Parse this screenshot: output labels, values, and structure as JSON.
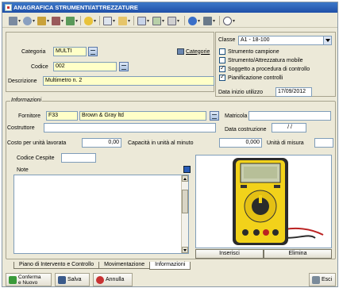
{
  "window": {
    "title": "ANAGRAFICA STRUMENTI/ATTREZZATURE"
  },
  "header_form": {
    "categoria_label": "Categoria",
    "categoria_value": "MULTI",
    "codice_label": "Codice",
    "codice_value": "002",
    "descrizione_label": "Descrizione",
    "descrizione_value": "Multimetro n. 2",
    "categorie_link": "Categorie"
  },
  "right_panel": {
    "classe_label": "Classe",
    "classe_value": "A1 - 18-100",
    "checkboxes": [
      {
        "label": "Strumento campione",
        "checked": false
      },
      {
        "label": "Strumento/Attrezzatura mobile",
        "checked": false
      },
      {
        "label": "Soggetto a procedura di controllo",
        "checked": true
      },
      {
        "label": "Pianificazione controlli",
        "checked": true
      }
    ],
    "data_inizio_label": "Data inizio utilizzo",
    "data_inizio_value": "17/09/2012"
  },
  "informazioni": {
    "legend": "Informazioni",
    "fornitore_label": "Fornitore",
    "fornitore_code": "F33",
    "fornitore_name": "Brown & Gray ltd",
    "matricola_label": "Matricola",
    "matricola_value": "",
    "costruttore_label": "Costruttore",
    "costruttore_value": "",
    "data_costruzione_label": "Data costruzione",
    "data_costruzione_value": "/  /",
    "costo_label": "Costo per unità lavorata",
    "costo_value": "0,00",
    "capacita_label": "Capacità in unità al minuto",
    "capacita_value": "0,000",
    "unita_label": "Unità di misura",
    "unita_value": "",
    "cespite_label": "Codice Cespite",
    "cespite_value": "",
    "note_label": "Note",
    "inserisci_label": "Inserisci",
    "elimina_label": "Elimina"
  },
  "tabs": [
    {
      "label": "Piano di Intervento e Controllo",
      "active": false
    },
    {
      "label": "Movimentazione",
      "active": false
    },
    {
      "label": "Informazioni",
      "active": true
    }
  ],
  "footer": {
    "conferma_line1": "Conferma",
    "conferma_line2": "e Nuovo",
    "salva_label": "Salva",
    "annulla_label": "Annulla",
    "esci_label": "Esci"
  },
  "colors": {
    "title_bar": "#2a5db8",
    "yellow_field": "#ffffc8",
    "meter_body": "#f2d21a",
    "meter_dark": "#2b2b2b"
  }
}
